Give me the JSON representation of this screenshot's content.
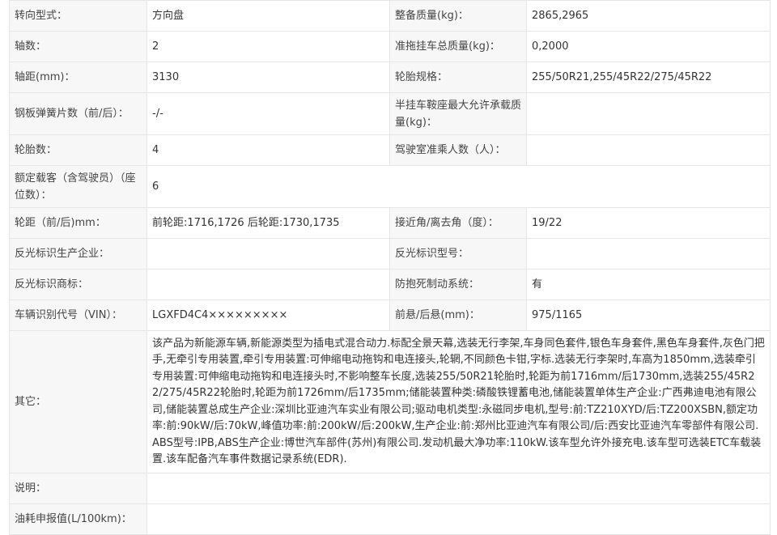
{
  "rows": [
    {
      "l1": "转向型式：",
      "v1": "方向盘",
      "l2": "整备质量(kg)：",
      "v2": "2865,2965"
    },
    {
      "l1": "轴数：",
      "v1": "2",
      "l2": "准拖挂车总质量(kg)：",
      "v2": "0,2000"
    },
    {
      "l1": "轴距(mm)：",
      "v1": "3130",
      "l2": "轮胎规格：",
      "v2": "255/50R21,255/45R22/275/45R22"
    },
    {
      "l1": "钢板弹簧片数（前/后）：",
      "v1": "-/-",
      "l2": "半挂车鞍座最大允许承载质量(kg)：",
      "v2": ""
    },
    {
      "l1": "轮胎数：",
      "v1": "4",
      "l2": "驾驶室准乘人数（人）：",
      "v2": ""
    },
    {
      "l1": "额定载客（含驾驶员）（座位数）：",
      "v1": "6"
    },
    {
      "l1": "轮距（前/后)mm：",
      "v1": "前轮距:1716,1726 后轮距:1730,1735",
      "l2": "接近角/离去角（度）：",
      "v2": "19/22"
    },
    {
      "l1": "反光标识生产企业：",
      "v1": "",
      "l2": "反光标识型号：",
      "v2": ""
    },
    {
      "l1": "反光标识商标：",
      "v1": "",
      "l2": "防抱死制动系统：",
      "v2": "有"
    },
    {
      "l1": "车辆识别代号（VIN）：",
      "v1": "LGXFD4C4×××××××××",
      "l2": "前悬/后悬(mm)：",
      "v2": "975/1165"
    },
    {
      "l1": "其它：",
      "v1": "该产品为新能源车辆,新能源类型为插电式混合动力.标配全景天幕,选装无行李架,车身同色套件,银色车身套件,黑色车身套件,灰色门把手,无牵引专用装置,牵引专用装置:可伸缩电动拖钩和电连接头,轮辋,不同颜色卡钳,字标.选装无行李架时,车高为1850mm,选装牵引专用装置:可伸缩电动拖钩和电连接头时,不影响整车长度,选装255/50R21轮胎时,轮距为前1716mm/后1730mm,选装255/45R22/275/45R22轮胎时,轮距为前1726mm/后1735mm;储能装置种类:磷酸铁锂蓄电池,储能装置单体生产企业:广西弗迪电池有限公司,储能装置总成生产企业:深圳比亚迪汽车实业有限公司;驱动电机类型:永磁同步电机,型号:前:TZ210XYD/后:TZ200XSBN,额定功率:前:90kW/后:70kW,峰值功率:前:200kW/后:200kW,生产企业:前:郑州比亚迪汽车有限公司/后:西安比亚迪汽车零部件有限公司.ABS型号:IPB,ABS生产企业:博世汽车部件(苏州)有限公司.发动机最大净功率:110kW.该车型允许外接充电.该车型可选装ETC车载装置.该车配备汽车事件数据记录系统(EDR)."
    },
    {
      "l1": "说明：",
      "v1": ""
    },
    {
      "l1": "油耗申报值(L/100km)：",
      "v1": ""
    }
  ]
}
